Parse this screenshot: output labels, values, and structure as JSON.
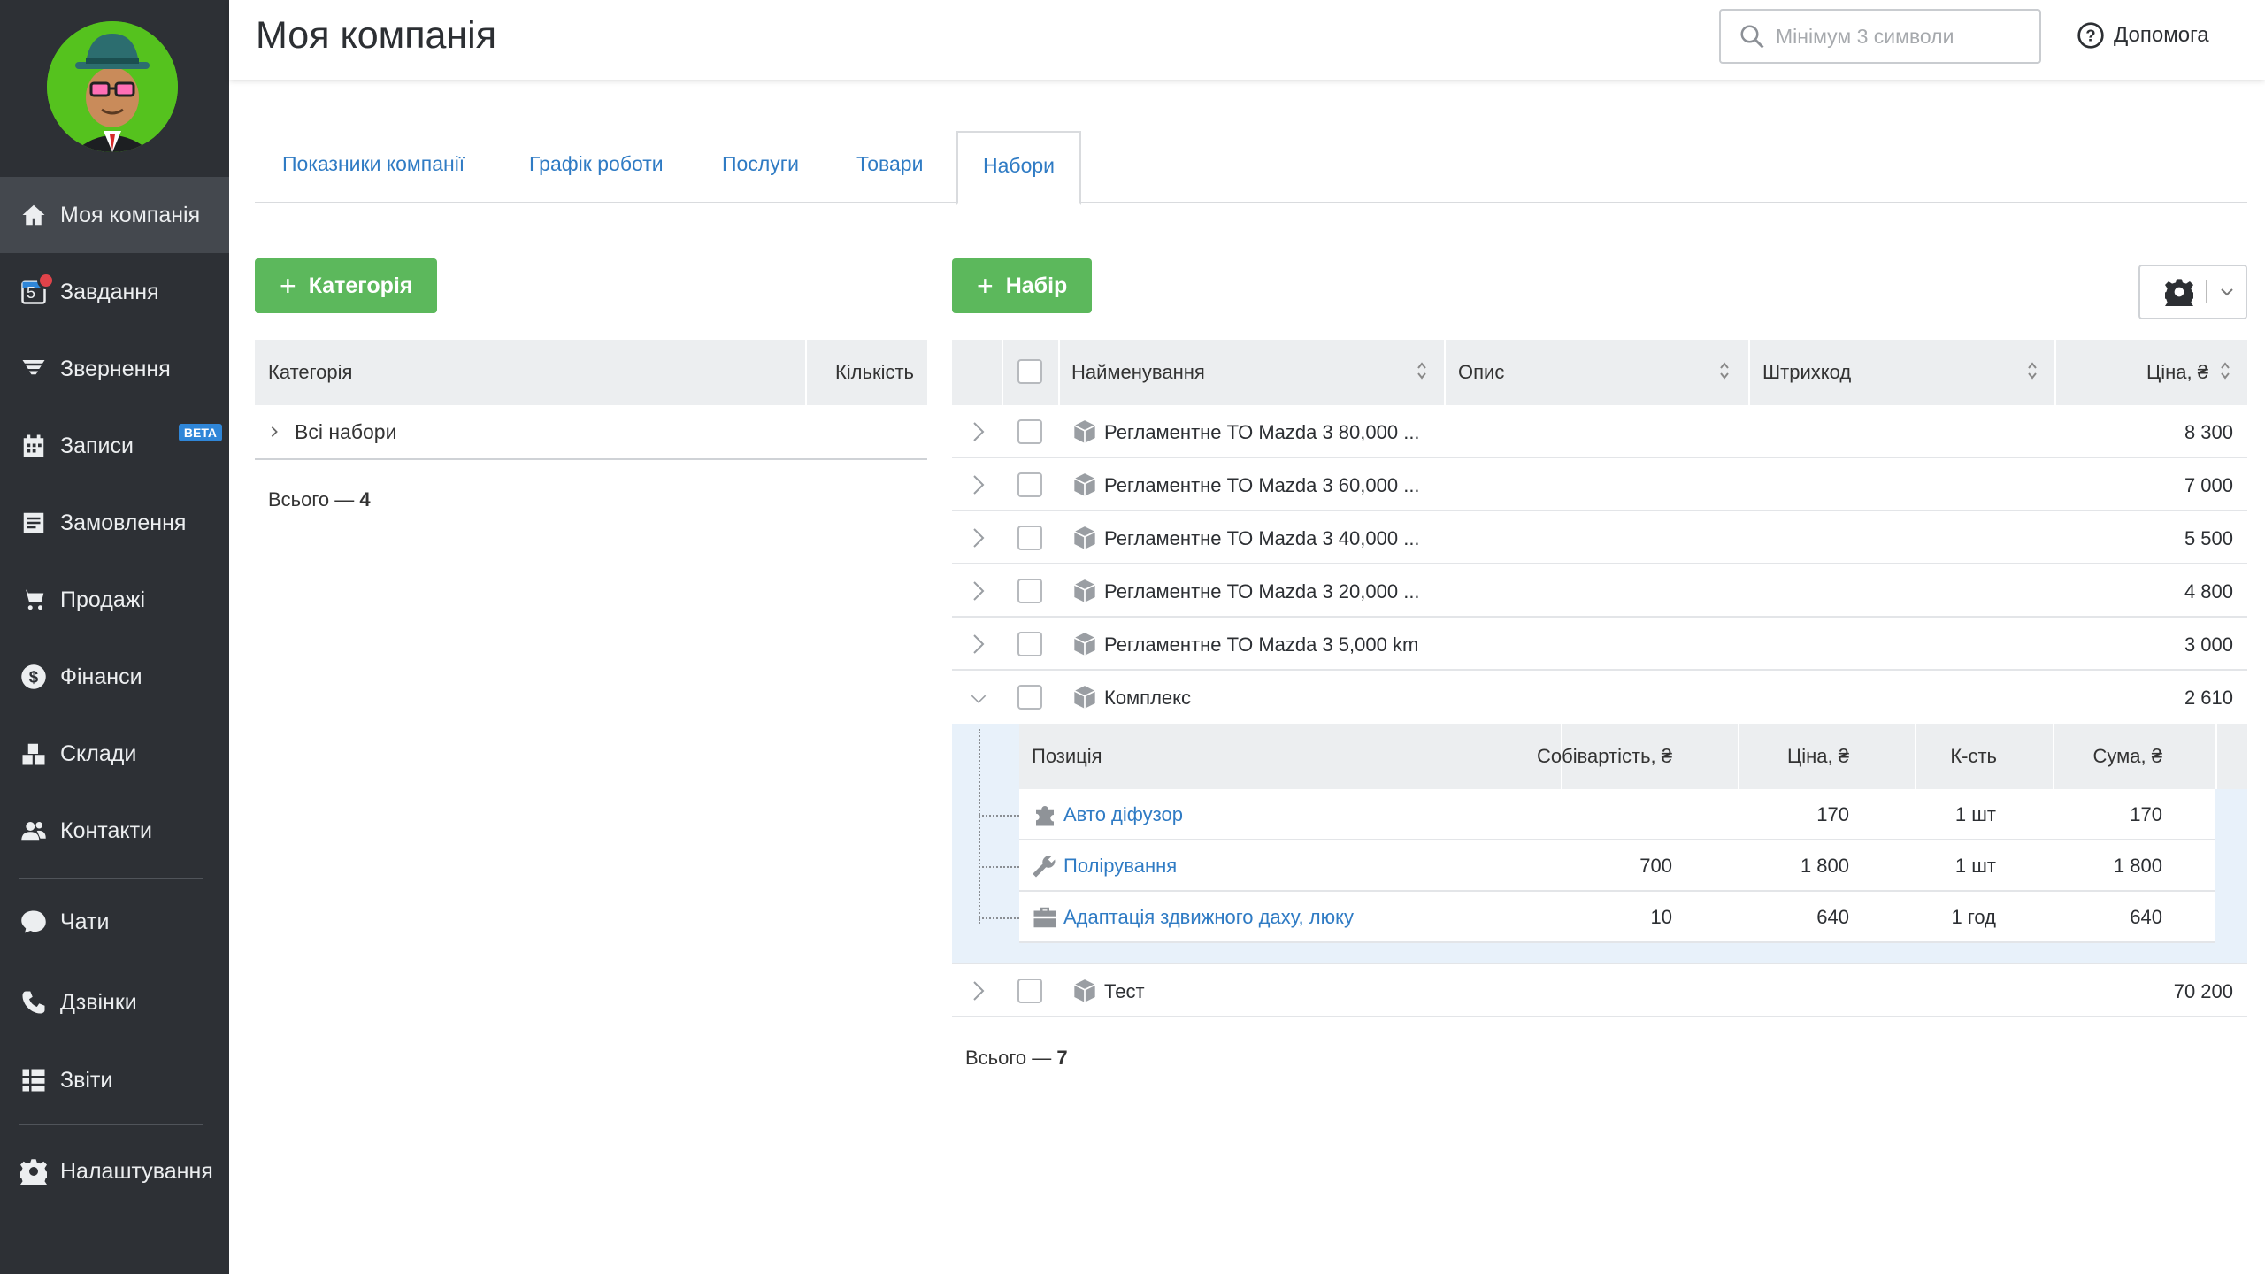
{
  "sidebar": {
    "items": [
      {
        "label": "Моя компанія",
        "icon": "home-icon"
      },
      {
        "label": "Завдання",
        "icon": "calendar-task-icon",
        "badge_num": "5"
      },
      {
        "label": "Звернення",
        "icon": "funnel-icon"
      },
      {
        "label": "Записи",
        "icon": "calendar-icon",
        "badge": "BETA"
      },
      {
        "label": "Замовлення",
        "icon": "order-icon"
      },
      {
        "label": "Продажі",
        "icon": "cart-icon"
      },
      {
        "label": "Фінанси",
        "icon": "dollar-icon"
      },
      {
        "label": "Склади",
        "icon": "warehouse-icon"
      },
      {
        "label": "Контакти",
        "icon": "contacts-icon"
      },
      {
        "label": "Чати",
        "icon": "chat-icon"
      },
      {
        "label": "Дзвінки",
        "icon": "phone-icon"
      },
      {
        "label": "Звіти",
        "icon": "reports-icon"
      },
      {
        "label": "Налаштування",
        "icon": "gear-icon"
      }
    ]
  },
  "header": {
    "title": "Моя компанія",
    "search_placeholder": "Мінімум 3 символи",
    "help_label": "Допомога"
  },
  "tabs": [
    {
      "label": "Показники компанії"
    },
    {
      "label": "Графік роботи"
    },
    {
      "label": "Послуги"
    },
    {
      "label": "Товари"
    },
    {
      "label": "Набори",
      "active": true
    }
  ],
  "left": {
    "add_category_label": "Категорія",
    "columns": {
      "category": "Категорія",
      "count": "Кількість"
    },
    "rows": [
      {
        "label": "Всі набори"
      }
    ],
    "total_label": "Всього —",
    "total_value": "4"
  },
  "right": {
    "add_set_label": "Набір",
    "columns": {
      "name": "Найменування",
      "description": "Опис",
      "barcode": "Штрихкод",
      "price": "Ціна, ₴"
    },
    "rows": [
      {
        "name": "Регламентне ТО Mazda 3 80,000 ...",
        "price": "8 300"
      },
      {
        "name": "Регламентне ТО Mazda 3 60,000 ...",
        "price": "7 000"
      },
      {
        "name": "Регламентне ТО Mazda 3 40,000 ...",
        "price": "5 500"
      },
      {
        "name": "Регламентне ТО Mazda 3 20,000 ...",
        "price": "4 800"
      },
      {
        "name": "Регламентне ТО Mazda 3 5,000 km",
        "price": "3 000"
      },
      {
        "name": "Комплекс",
        "price": "2 610",
        "expanded": true
      },
      {
        "name": "Тест",
        "price": "70 200"
      }
    ],
    "sub": {
      "columns": {
        "position": "Позиція",
        "cost": "Собівартість, ₴",
        "price": "Ціна, ₴",
        "qty": "К-сть",
        "sum": "Сума, ₴"
      },
      "rows": [
        {
          "name": "Авто дiфузор",
          "icon": "puzzle-icon",
          "cost": "",
          "price": "170",
          "qty": "1 шт",
          "sum": "170"
        },
        {
          "name": "Полірування",
          "icon": "wrench-icon",
          "cost": "700",
          "price": "1 800",
          "qty": "1 шт",
          "sum": "1 800"
        },
        {
          "name": "Адаптація здвижного даху, люку",
          "icon": "briefcase-icon",
          "cost": "10",
          "price": "640",
          "qty": "1 год",
          "sum": "640"
        }
      ]
    },
    "total_label": "Всього —",
    "total_value": "7"
  },
  "colors": {
    "sidebar": "#2d3035",
    "active_item": "#44484e",
    "green": "#5cb85c",
    "link": "#2f7bc4",
    "beta": "#2f86d8"
  }
}
